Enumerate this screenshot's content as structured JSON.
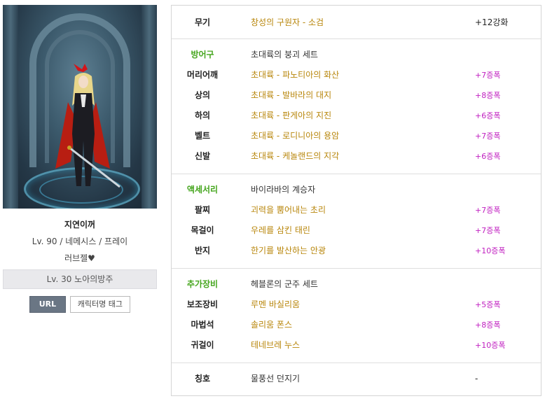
{
  "profile": {
    "name": "지연이꺼",
    "info": "Lv. 90 / 네메시스 / 프레이",
    "guild": "러브젤♥",
    "adventure": "Lv. 30 노아의방주",
    "url_button": "URL",
    "tag_button": "캐릭터명 태그"
  },
  "equipment": {
    "weapon": {
      "category": "무기",
      "name": "창성의 구원자 - 소검",
      "enhance": "+12강화"
    },
    "armor": {
      "category": "방어구",
      "set": "초대륙의 붕괴 세트",
      "items": [
        {
          "slot": "머리어깨",
          "name": "초대륙 - 파노티아의 화산",
          "enhance": "+7증폭"
        },
        {
          "slot": "상의",
          "name": "초대륙 - 발바라의 대지",
          "enhance": "+8증폭"
        },
        {
          "slot": "하의",
          "name": "초대륙 - 판게아의 지진",
          "enhance": "+6증폭"
        },
        {
          "slot": "벨트",
          "name": "초대륙 - 로디니아의 용암",
          "enhance": "+7증폭"
        },
        {
          "slot": "신발",
          "name": "초대륙 - 케놀랜드의 지각",
          "enhance": "+6증폭"
        }
      ]
    },
    "accessory": {
      "category": "액세서리",
      "set": "바이라바의 계승자",
      "items": [
        {
          "slot": "팔찌",
          "name": "괴력을 뿜어내는 초리",
          "enhance": "+7증폭"
        },
        {
          "slot": "목걸이",
          "name": "우레를 삼킨 태린",
          "enhance": "+7증폭"
        },
        {
          "slot": "반지",
          "name": "한기를 발산하는 안광",
          "enhance": "+10증폭"
        }
      ]
    },
    "special": {
      "category": "추가장비",
      "set": "헤블론의 군주 세트",
      "items": [
        {
          "slot": "보조장비",
          "name": "루멘 바실리움",
          "enhance": "+5증폭"
        },
        {
          "slot": "마법석",
          "name": "솔리움 폰스",
          "enhance": "+8증폭"
        },
        {
          "slot": "귀걸이",
          "name": "테네브레 누스",
          "enhance": "+10증폭"
        }
      ]
    },
    "title": {
      "category": "칭호",
      "name": "물풍선 던지기",
      "enhance": "-"
    }
  },
  "colors": {
    "item_gold": "#b8860b",
    "category_green": "#44a51c",
    "enhance_magenta": "#c020c0"
  }
}
